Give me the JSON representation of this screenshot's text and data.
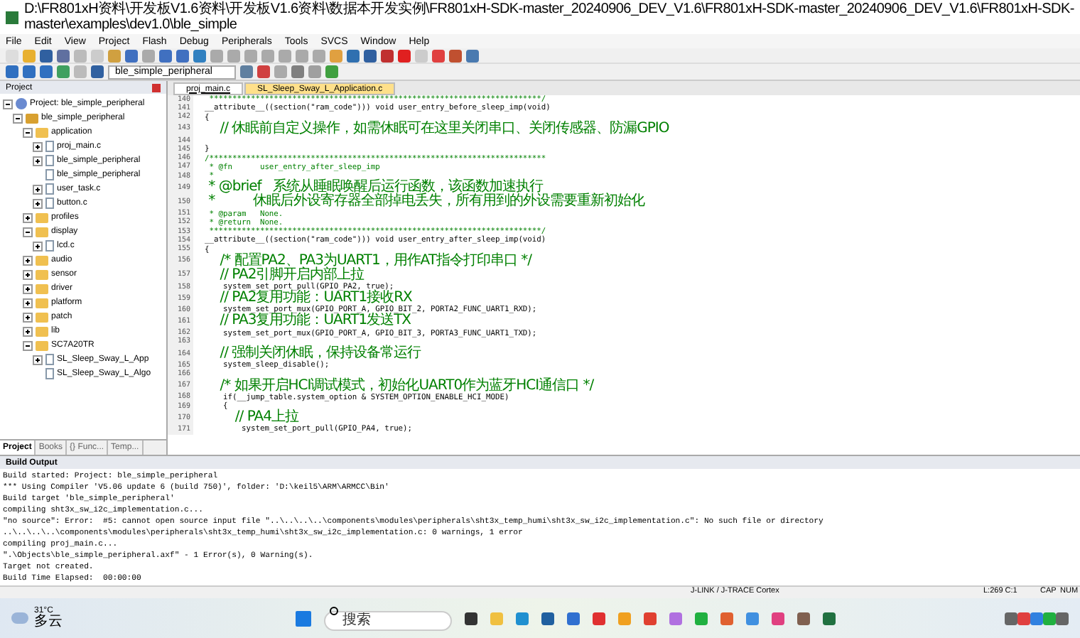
{
  "window": {
    "title": "D:\\FR801xH资料\\开发板V1.6资料\\开发板V1.6资料\\数据本开发实例\\FR801xH-SDK-master_20240906_DEV_V1.6\\FR801xH-SDK-master_20240906_DEV_V1.6\\FR801xH-SDK-master\\examples\\dev1.0\\ble_simple"
  },
  "menu": [
    "File",
    "Edit",
    "View",
    "Project",
    "Flash",
    "Debug",
    "Peripherals",
    "Tools",
    "SVCS",
    "Window",
    "Help"
  ],
  "toolbar": {
    "target": "ble_simple_peripheral"
  },
  "project": {
    "title": "Project",
    "tree": [
      {
        "label": "Project: ble_simple_peripheral",
        "expanded": true,
        "kind": "root",
        "children": [
          {
            "label": "ble_simple_peripheral",
            "expanded": true,
            "kind": "target",
            "children": [
              {
                "label": "application",
                "expanded": true,
                "kind": "folder",
                "children": [
                  {
                    "label": "proj_main.c",
                    "expanded": false,
                    "kind": "file"
                  },
                  {
                    "label": "ble_simple_peripheral",
                    "expanded": false,
                    "kind": "file"
                  },
                  {
                    "label": "ble_simple_peripheral",
                    "kind": "file"
                  },
                  {
                    "label": "user_task.c",
                    "expanded": false,
                    "kind": "file"
                  },
                  {
                    "label": "button.c",
                    "expanded": false,
                    "kind": "file"
                  }
                ]
              },
              {
                "label": "profiles",
                "expanded": false,
                "kind": "folder"
              },
              {
                "label": "display",
                "expanded": true,
                "kind": "folder",
                "children": [
                  {
                    "label": "lcd.c",
                    "expanded": false,
                    "kind": "file"
                  }
                ]
              },
              {
                "label": "audio",
                "expanded": false,
                "kind": "folder"
              },
              {
                "label": "sensor",
                "expanded": false,
                "kind": "folder"
              },
              {
                "label": "driver",
                "expanded": false,
                "kind": "folder"
              },
              {
                "label": "platform",
                "expanded": false,
                "kind": "folder"
              },
              {
                "label": "patch",
                "expanded": false,
                "kind": "folder"
              },
              {
                "label": "lib",
                "expanded": false,
                "kind": "folder"
              },
              {
                "label": "SC7A20TR",
                "expanded": true,
                "kind": "folder",
                "children": [
                  {
                    "label": "SL_Sleep_Sway_L_App",
                    "expanded": false,
                    "kind": "file"
                  },
                  {
                    "label": "SL_Sleep_Sway_L_Algo",
                    "kind": "file"
                  }
                ]
              }
            ]
          }
        ]
      }
    ],
    "tabs": [
      {
        "label": "Project",
        "selected": true
      },
      {
        "label": "Books",
        "selected": false
      },
      {
        "label": "{} Func...",
        "selected": false
      },
      {
        "label": "Temp...",
        "selected": false
      }
    ]
  },
  "editor": {
    "tabs": [
      {
        "label": "proj_main.c",
        "selected": false
      },
      {
        "label": "SL_Sleep_Sway_L_Application.c",
        "selected": true
      }
    ],
    "lines": [
      {
        "n": "140",
        "kind": "comment",
        "text": " ************************************************************************/"
      },
      {
        "n": "141",
        "kind": "code",
        "text": "__attribute__((section(\"ram_code\"))) void user_entry_before_sleep_imp(void)"
      },
      {
        "n": "142",
        "kind": "code",
        "text": "{"
      },
      {
        "n": "143",
        "kind": "comment",
        "text": "    // 休眠前自定义操作，如需休眠可在这里关闭串口、关闭传感器、防漏GPIO"
      },
      {
        "n": "144"
      },
      {
        "n": "145",
        "kind": "code",
        "text": "}"
      },
      {
        "n": "146",
        "kind": "comment",
        "text": "/*************************************************************************"
      },
      {
        "n": "147",
        "kind": "comment",
        "text": " * @fn      user_entry_after_sleep_imp"
      },
      {
        "n": "148",
        "kind": "comment",
        "text": " *"
      },
      {
        "n": "149",
        "kind": "comment",
        "text": " * @brief   系统从睡眠唤醒后运行函数，该函数加速执行"
      },
      {
        "n": "150",
        "kind": "comment",
        "text": " *          休眠后外设寄存器全部掉电丢失，所有用到的外设需要重新初始化"
      },
      {
        "n": "151",
        "kind": "comment",
        "text": " * @param   None."
      },
      {
        "n": "152",
        "kind": "comment",
        "text": " * @return  None."
      },
      {
        "n": "153",
        "kind": "comment",
        "text": " ************************************************************************/"
      },
      {
        "n": "154",
        "kind": "code",
        "text": "__attribute__((section(\"ram_code\"))) void user_entry_after_sleep_imp(void)"
      },
      {
        "n": "155",
        "kind": "code",
        "text": "{"
      },
      {
        "n": "156",
        "kind": "comment",
        "text": "    /* 配置PA2、PA3为UART1，用作AT指令打印串口 */"
      },
      {
        "n": "157",
        "kind": "comment",
        "text": "    // PA2引脚开启内部上拉"
      },
      {
        "n": "158",
        "kind": "code",
        "text": "    system_set_port_pull(GPIO_PA2, true);"
      },
      {
        "n": "159",
        "kind": "comment",
        "text": "    // PA2复用功能：UART1接收RX"
      },
      {
        "n": "160",
        "kind": "code",
        "text": "    system_set_port_mux(GPIO_PORT_A, GPIO_BIT_2, PORTA2_FUNC_UART1_RXD);"
      },
      {
        "n": "161",
        "kind": "comment",
        "text": "    // PA3复用功能：UART1发送TX"
      },
      {
        "n": "162",
        "kind": "code",
        "text": "    system_set_port_mux(GPIO_PORT_A, GPIO_BIT_3, PORTA3_FUNC_UART1_TXD);"
      },
      {
        "n": "163"
      },
      {
        "n": "164",
        "kind": "comment",
        "text": "    // 强制关闭休眠，保持设备常运行"
      },
      {
        "n": "165",
        "kind": "code",
        "text": "    system_sleep_disable();"
      },
      {
        "n": "166"
      },
      {
        "n": "167",
        "kind": "comment",
        "text": "    /* 如果开启HCI调试模式，初始化UART0作为蓝牙HCI通信口 */"
      },
      {
        "n": "168",
        "kind": "code",
        "text": "    if(__jump_table.system_option & SYSTEM_OPTION_ENABLE_HCI_MODE)"
      },
      {
        "n": "169",
        "kind": "code",
        "text": "    {"
      },
      {
        "n": "170",
        "kind": "comment",
        "text": "        // PA4上拉"
      },
      {
        "n": "171",
        "kind": "code",
        "text": "        system_set_port_pull(GPIO_PA4, true);"
      }
    ]
  },
  "build_output": {
    "title": "Build Output",
    "lines": [
      "Build started: Project: ble_simple_peripheral",
      "*** Using Compiler 'V5.06 update 6 (build 750)', folder: 'D:\\keil5\\ARM\\ARMCC\\Bin'",
      "Build target 'ble_simple_peripheral'",
      "compiling sht3x_sw_i2c_implementation.c...",
      "\"no source\": Error:  #5: cannot open source input file \"..\\..\\..\\..\\components\\modules\\peripherals\\sht3x_temp_humi\\sht3x_sw_i2c_implementation.c\": No such file or directory",
      "..\\..\\..\\..\\components\\modules\\peripherals\\sht3x_temp_humi\\sht3x_sw_i2c_implementation.c: 0 warnings, 1 error",
      "compiling proj_main.c...",
      "\".\\Objects\\ble_simple_peripheral.axf\" - 1 Error(s), 0 Warning(s).",
      "Target not created.",
      "Build Time Elapsed:  00:00:00"
    ]
  },
  "status_bar": {
    "debugger": "J-LINK / J-TRACE Cortex",
    "position": "L:269 C:1",
    "caps": "CAP",
    "num": "NUM"
  },
  "taskbar": {
    "temperature": "31°C",
    "weather": "多云",
    "search": {
      "placeholder": "搜索"
    }
  }
}
